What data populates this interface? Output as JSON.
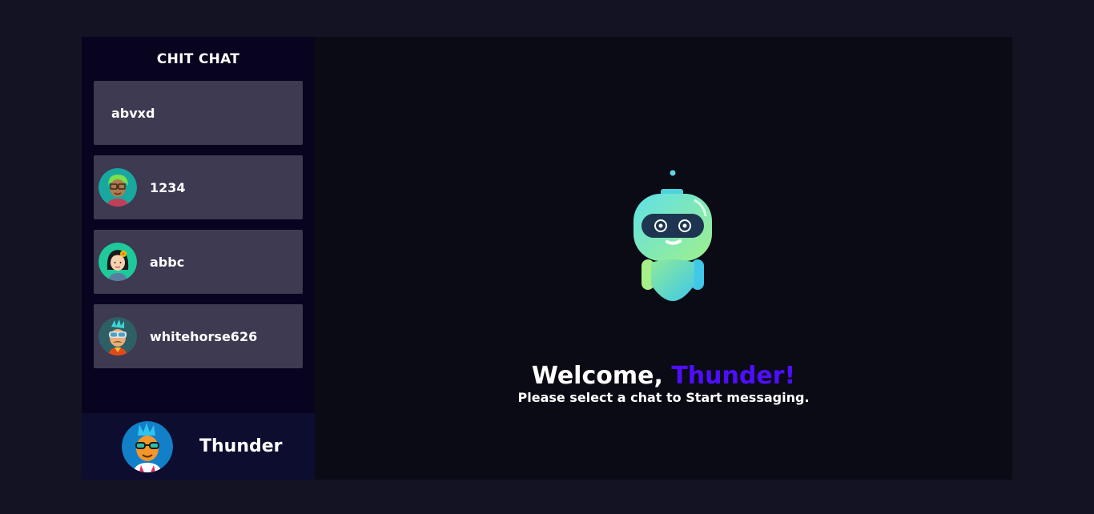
{
  "sidebar": {
    "brand": "CHIT CHAT",
    "contacts": [
      {
        "name": "abvxd",
        "avatar": "none"
      },
      {
        "name": "1234",
        "avatar": "green-hair-glasses-avatar"
      },
      {
        "name": "abbc",
        "avatar": "girl-flower-avatar"
      },
      {
        "name": "whitehorse626",
        "avatar": "goggles-mustache-avatar"
      }
    ]
  },
  "current_user": {
    "name": "Thunder",
    "avatar": "blue-hair-sunglasses-avatar"
  },
  "welcome": {
    "prefix": "Welcome,",
    "username": "Thunder!",
    "subtitle": "Please select a chat to Start messaging."
  },
  "colors": {
    "background": "#131324",
    "sidebar": "#080420",
    "contact_card": "#3d3a51",
    "current_user_bar": "#0d0d30",
    "accent": "#4e0eff",
    "main": "#0b0b15"
  }
}
